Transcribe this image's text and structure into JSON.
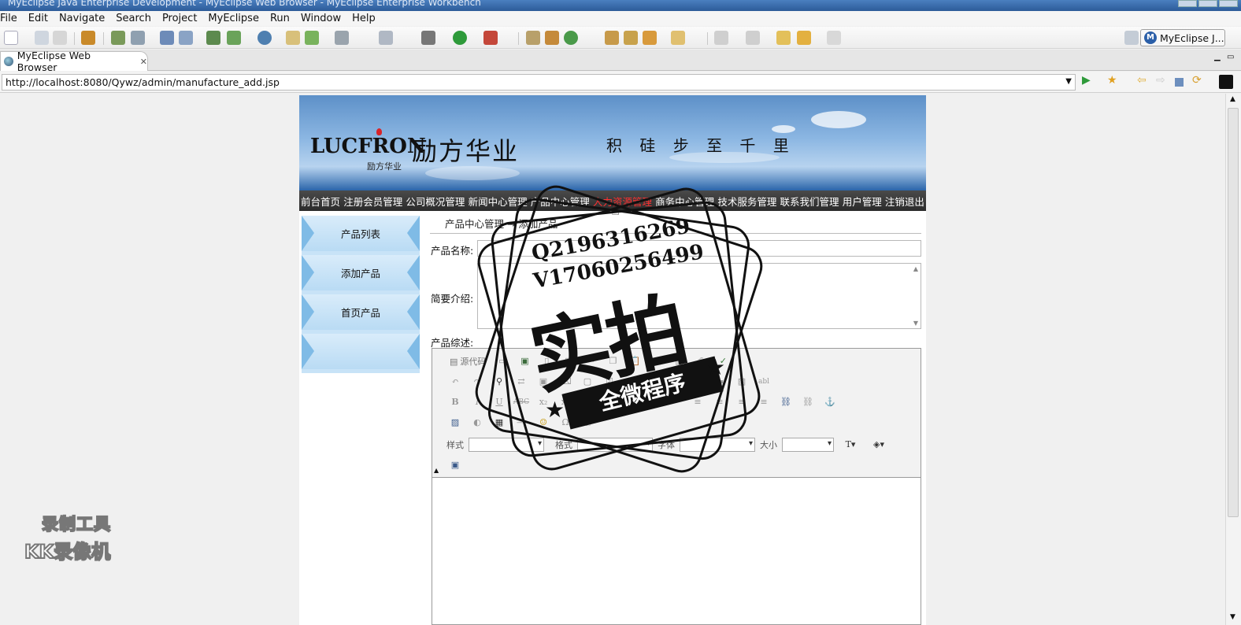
{
  "window": {
    "title": "MyEclipse Java Enterprise Development - MyEclipse Web Browser - MyEclipse Enterprise Workbench"
  },
  "menu": [
    "File",
    "Edit",
    "Navigate",
    "Search",
    "Project",
    "MyEclipse",
    "Run",
    "Window",
    "Help"
  ],
  "perspective": {
    "label": "MyEclipse J..."
  },
  "tab": {
    "label": "MyEclipse Web Browser"
  },
  "url": "http://localhost:8080/Qywz/admin/manufacture_add.jsp",
  "banner": {
    "logo_word": "LUCFRON",
    "logo_cn": "励方华业",
    "logo_sub": "励方华业",
    "slogan": "积 硅 步 至 千 里"
  },
  "nav": [
    {
      "label": "前台首页",
      "active": false
    },
    {
      "label": "注册会员管理",
      "active": false
    },
    {
      "label": "公司概况管理",
      "active": false
    },
    {
      "label": "新闻中心管理",
      "active": false
    },
    {
      "label": "产品中心管理",
      "active": false
    },
    {
      "label": "人力资源管理",
      "active": true
    },
    {
      "label": "商务中心管理",
      "active": false
    },
    {
      "label": "技术服务管理",
      "active": false
    },
    {
      "label": "联系我们管理",
      "active": false
    },
    {
      "label": "用户管理",
      "active": false
    },
    {
      "label": "注销退出",
      "active": false
    }
  ],
  "sidebar": [
    "产品列表",
    "添加产品",
    "首页产品",
    ""
  ],
  "breadcrumb": "产品中心管理 → 添加产品",
  "form": {
    "name_label": "产品名称:",
    "intro_label": "简要介绍:",
    "desc_label": "产品综述:"
  },
  "editor": {
    "source_label": "源代码",
    "style_label": "样式",
    "format_label": "格式",
    "font_label": "字体",
    "size_label": "大小"
  },
  "watermarks": {
    "stamp_q": "Q2196316269",
    "stamp_v": "V17060256499",
    "stamp_big": "实拍",
    "stamp_ribbon": "全微程序",
    "recorder_1": "录制工具",
    "recorder_2": "KK录像机"
  },
  "colors": {
    "nav_active": "#ff3030",
    "sidebar": "#c8e3f7",
    "navbar": "#333333"
  }
}
